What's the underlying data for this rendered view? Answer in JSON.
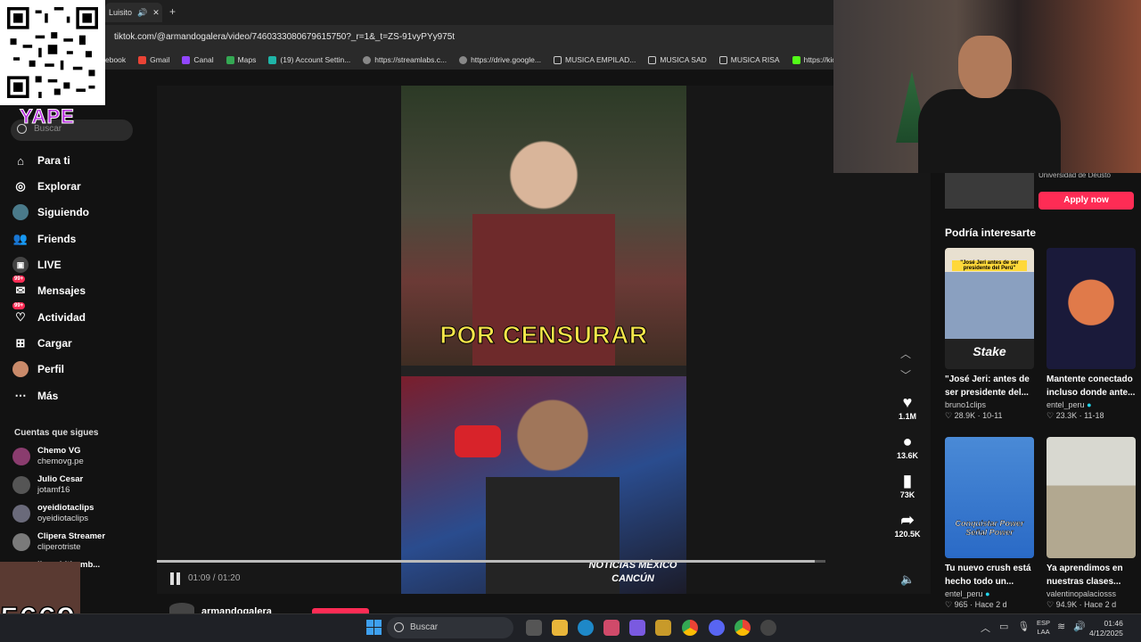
{
  "browser": {
    "tab_title": "Luisito",
    "url": "tiktok.com/@armandogalera/video/7460333080679615750?_r=1&_t=ZS-91vyPYy975t",
    "bookmarks": [
      "ebook",
      "Gmail",
      "Canal",
      "Maps",
      "(19) Account Settin...",
      "https://streamlabs.c...",
      "https://drive.google...",
      "MUSICA EMPILAD...",
      "MUSICA SAD",
      "MUSICA RISA",
      "https://kick.com/je"
    ]
  },
  "overlay": {
    "donation_brand": "YAPE",
    "counter": "5669"
  },
  "sidebar": {
    "search_placeholder": "Buscar",
    "nav": [
      {
        "label": "Para ti",
        "icon": "home-icon"
      },
      {
        "label": "Explorar",
        "icon": "compass-icon"
      },
      {
        "label": "Siguiendo",
        "icon": "following-icon"
      },
      {
        "label": "Friends",
        "icon": "friends-icon"
      },
      {
        "label": "LIVE",
        "icon": "live-icon"
      },
      {
        "label": "Mensajes",
        "icon": "messages-icon",
        "badge": "99+"
      },
      {
        "label": "Actividad",
        "icon": "activity-icon",
        "badge": "99+"
      },
      {
        "label": "Cargar",
        "icon": "upload-icon"
      },
      {
        "label": "Perfil",
        "icon": "profile-icon"
      },
      {
        "label": "Más",
        "icon": "more-icon"
      }
    ],
    "following_title": "Cuentas que sigues",
    "accounts": [
      {
        "name": "Chemo VG",
        "handle": "chemovg.pe"
      },
      {
        "name": "Julio Cesar",
        "handle": "jotamf16"
      },
      {
        "name": "oyeidiotaclips",
        "handle": "oyeidiotaclips"
      },
      {
        "name": "Clipera Streamer",
        "handle": "cliperotriste"
      },
      {
        "name": "jhonzhithomb...",
        "handle": "endoza671"
      }
    ],
    "more_label": "ás"
  },
  "player": {
    "caption": "POR CENSURAR",
    "watermark_line1": "NOTICIAS MÉXICO",
    "watermark_line2": "CANCÚN",
    "progress": 0.984,
    "time": "01:09 / 01:20",
    "author": "armandogalera"
  },
  "actions": {
    "likes": "1.1M",
    "comments": "13.6K",
    "saves": "73K",
    "shares": "120.5K"
  },
  "ad": {
    "sponsor": "Universidad de Deusto",
    "cta": "Apply now"
  },
  "recommendations": {
    "title": "Podría interesarte",
    "cards": [
      {
        "title": "\"José Jeri: antes de ser presidente del...",
        "author": "bruno1clips",
        "likes": "28.9K",
        "date": "10-11"
      },
      {
        "title": "Mantente conectado incluso donde ante...",
        "author": "entel_peru",
        "likes": "23.3K",
        "date": "11-18"
      },
      {
        "title": "Tu nuevo crush está hecho todo un...",
        "author": "entel_peru",
        "likes": "965",
        "date": "Hace 2 d"
      },
      {
        "title": "Ya aprendimos en nuestras clases...",
        "author": "valentinopalaciosss",
        "likes": "94.9K",
        "date": "Hace 2 d"
      }
    ],
    "thumb_texts": [
      "\"José Jeri antes de ser presidente del Perú\"",
      "Stake",
      "Conquistar Power Señal Power"
    ]
  },
  "taskbar": {
    "search": "Buscar",
    "lang_1": "ESP",
    "lang_2": "LAA",
    "time": "01:46",
    "date": "4/12/2025"
  }
}
